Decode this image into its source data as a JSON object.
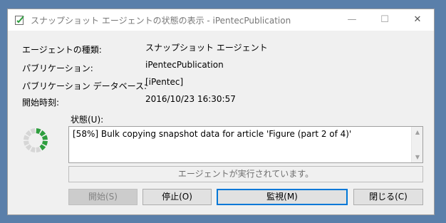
{
  "window": {
    "title": "スナップショット エージェントの状態の表示 - iPentecPublication",
    "min_glyph": "—",
    "max_glyph": "☐",
    "close_glyph": "✕"
  },
  "details": {
    "agent_type_label": "エージェントの種類:",
    "agent_type_value": "スナップショット エージェント",
    "publication_label": "パブリケーション:",
    "publication_value": "iPentecPublication",
    "database_label": "パブリケーション データベース:",
    "database_value": "[iPentec]",
    "start_time_label": "開始時刻:",
    "start_time_value": "2016/10/23 16:30:57"
  },
  "status": {
    "label": "状態(U):",
    "text": "[58%] Bulk copying snapshot data for article 'Figure (part 2 of 4)'",
    "scroll_up": "▲",
    "scroll_down": "▼"
  },
  "message": "エージェントが実行されています。",
  "buttons": {
    "start": "開始(S)",
    "stop": "停止(O)",
    "monitor": "監視(M)",
    "close": "閉じる(C)"
  },
  "colors": {
    "spinner_active": "#2e9e3e",
    "spinner_inactive": "#d6d6d6",
    "focus_border": "#0078d7"
  },
  "icons": {
    "title": "agent-status-icon",
    "spinner": "progress-spinner-icon"
  }
}
